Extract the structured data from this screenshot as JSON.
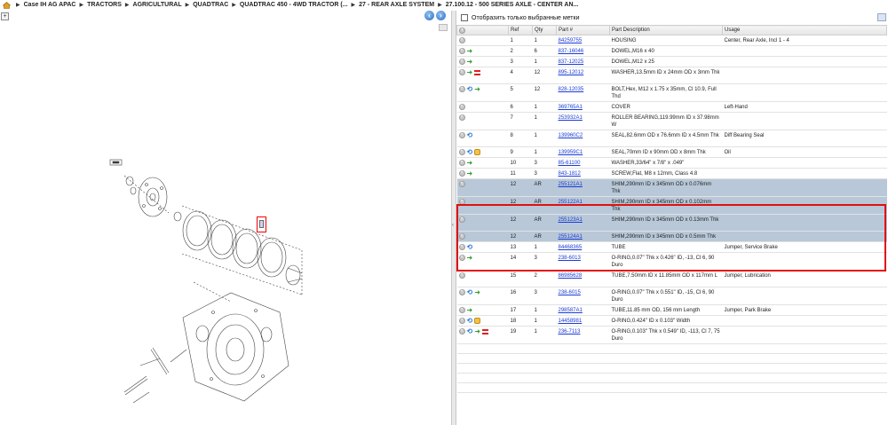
{
  "breadcrumb": {
    "items": [
      "Case IH AG APAC",
      "TRACTORS",
      "AGRICULTURAL",
      "QUADTRAC",
      "QUADTRAC 450 - 4WD TRACTOR (...",
      "27 - REAR AXLE SYSTEM",
      "27.100.12 - 500 SERIES AXLE - CENTER AN..."
    ]
  },
  "left_pane": {
    "expand_label": "+",
    "prev_label": "‹",
    "next_label": "›"
  },
  "filter": {
    "label": "Отобразить только выбранные метки"
  },
  "table": {
    "headers": [
      "",
      "Ref",
      "Qty",
      "Part #",
      "Part Description",
      "Usage"
    ],
    "rows": [
      {
        "icons": [
          "plus"
        ],
        "ref": "1",
        "qty": "1",
        "part": "84259755",
        "desc": "HOUSING",
        "usage": "Center, Rear Axle, Incl 1 - 4",
        "tall": false,
        "selected": false
      },
      {
        "icons": [
          "plus",
          "arrow"
        ],
        "ref": "2",
        "qty": "6",
        "part": "837-16046",
        "desc": "DOWEL,M16 x 40",
        "usage": "",
        "tall": false,
        "selected": false
      },
      {
        "icons": [
          "plus",
          "arrow"
        ],
        "ref": "3",
        "qty": "1",
        "part": "837-12025",
        "desc": "DOWEL,M12 x 25",
        "usage": "",
        "tall": false,
        "selected": false
      },
      {
        "icons": [
          "plus",
          "arrow",
          "flag"
        ],
        "ref": "4",
        "qty": "12",
        "part": "895-12012",
        "desc": "WASHER,13.5mm ID x 24mm OD x 3mm Thk",
        "usage": "",
        "tall": true,
        "selected": false
      },
      {
        "icons": [
          "plus",
          "recycle",
          "arrow"
        ],
        "ref": "5",
        "qty": "12",
        "part": "828-12035",
        "desc": "BOLT,Hex, M12 x 1.75 x 35mm, Cl 10.9, Full Thd",
        "usage": "",
        "tall": true,
        "selected": false
      },
      {
        "icons": [
          "plus"
        ],
        "ref": "6",
        "qty": "1",
        "part": "369765A1",
        "desc": "COVER",
        "usage": "Left-Hand",
        "tall": false,
        "selected": false
      },
      {
        "icons": [
          "plus"
        ],
        "ref": "7",
        "qty": "1",
        "part": "253932A1",
        "desc": "ROLLER BEARING,119.99mm ID x 37.98mm W",
        "usage": "",
        "tall": true,
        "selected": false
      },
      {
        "icons": [
          "plus",
          "recycle"
        ],
        "ref": "8",
        "qty": "1",
        "part": "139960C2",
        "desc": "SEAL,82.6mm OD x 76.6mm ID x 4.5mm Thk",
        "usage": "Diff Bearing Seal",
        "tall": true,
        "selected": false
      },
      {
        "icons": [
          "plus",
          "recycle",
          "note"
        ],
        "ref": "9",
        "qty": "1",
        "part": "139959C1",
        "desc": "SEAL,70mm ID x 90mm OD x 8mm Thk",
        "usage": "Oil",
        "tall": false,
        "selected": false
      },
      {
        "icons": [
          "plus",
          "arrow"
        ],
        "ref": "10",
        "qty": "3",
        "part": "85-61100",
        "desc": "WASHER,33/64\" x 7/8\" x .049\"",
        "usage": "",
        "tall": false,
        "selected": false
      },
      {
        "icons": [
          "plus",
          "arrow"
        ],
        "ref": "11",
        "qty": "3",
        "part": "843-1812",
        "desc": "SCREW,Flat, M8 x 12mm, Class 4.8",
        "usage": "",
        "tall": false,
        "selected": false
      },
      {
        "icons": [
          "plus"
        ],
        "ref": "12",
        "qty": "AR",
        "part": "255121A1",
        "desc": "SHIM,290mm ID x 345mm OD x 0.076mm Thk",
        "usage": "",
        "tall": true,
        "selected": true
      },
      {
        "icons": [
          "plus"
        ],
        "ref": "12",
        "qty": "AR",
        "part": "255122A1",
        "desc": "SHIM,290mm ID x 345mm OD x 0.102mm Thk",
        "usage": "",
        "tall": true,
        "selected": true
      },
      {
        "icons": [
          "plus"
        ],
        "ref": "12",
        "qty": "AR",
        "part": "255123A1",
        "desc": "SHIM,290mm ID x 345mm OD x 0.13mm Thk",
        "usage": "",
        "tall": true,
        "selected": true
      },
      {
        "icons": [
          "plus"
        ],
        "ref": "12",
        "qty": "AR",
        "part": "255124A1",
        "desc": "SHIM,290mm ID x 345mm OD x 0.5mm Thk",
        "usage": "",
        "tall": false,
        "selected": true
      },
      {
        "icons": [
          "plus",
          "recycle"
        ],
        "ref": "13",
        "qty": "1",
        "part": "84468365",
        "desc": "TUBE",
        "usage": "Jumper, Service Brake",
        "tall": false,
        "selected": false
      },
      {
        "icons": [
          "plus",
          "arrow"
        ],
        "ref": "14",
        "qty": "3",
        "part": "238-6013",
        "desc": "O-RING,0.07\" Thk x 0.426\" ID, -13, Cl 6, 90 Duro",
        "usage": "",
        "tall": true,
        "selected": false
      },
      {
        "icons": [
          "plus"
        ],
        "ref": "15",
        "qty": "2",
        "part": "86985628",
        "desc": "TUBE,7.50mm ID x 11.85mm OD x 117mm L",
        "usage": "Jumper, Lubrication",
        "tall": true,
        "selected": false
      },
      {
        "icons": [
          "plus",
          "recycle",
          "arrow"
        ],
        "ref": "16",
        "qty": "3",
        "part": "238-6015",
        "desc": "O-RING,0.07\" Thk x 0.551\" ID, -15, Cl 6, 90 Duro",
        "usage": "",
        "tall": true,
        "selected": false
      },
      {
        "icons": [
          "plus",
          "arrow"
        ],
        "ref": "17",
        "qty": "1",
        "part": "298587A1",
        "desc": "TUBE,11.85 mm OD, 156 mm Length",
        "usage": "Jumper, Park Brake",
        "tall": false,
        "selected": false
      },
      {
        "icons": [
          "plus",
          "recycle",
          "note"
        ],
        "ref": "18",
        "qty": "1",
        "part": "14458981",
        "desc": "O-RING,0.424\" ID x 0.103\" Width",
        "usage": "",
        "tall": false,
        "selected": false
      },
      {
        "icons": [
          "plus",
          "recycle",
          "arrow",
          "flag"
        ],
        "ref": "19",
        "qty": "1",
        "part": "236-7113",
        "desc": "O-RING,0.103\" Thk x 0.549\" ID, -113, Cl 7, 75 Duro",
        "usage": "",
        "tall": true,
        "selected": false
      }
    ]
  }
}
